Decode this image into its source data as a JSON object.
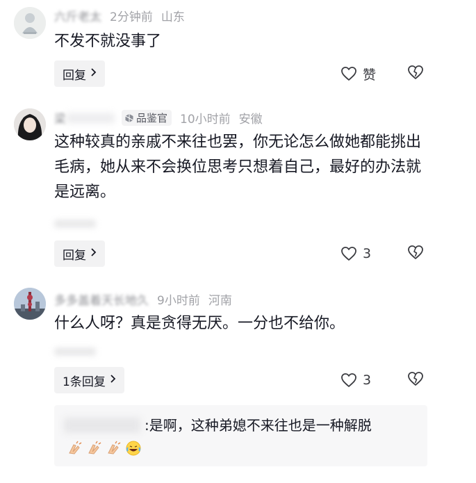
{
  "comments": [
    {
      "author": "六斤老太",
      "time": "2分钟前",
      "location": "山东",
      "text": "不发不就没事了",
      "reply_label": "回复",
      "like_label": "赞"
    },
    {
      "author": "梁",
      "badge": "品鉴官",
      "time": "10小时前",
      "location": "安徽",
      "text": "这种较真的亲戚不来往也罢，你无论怎么做她都能挑出毛病，她从来不会换位思考只想着自己，最好的办法就是远离。",
      "reply_label": "回复",
      "like_count": "3"
    },
    {
      "author": "多多盖着天长地久",
      "time": "9小时前",
      "location": "河南",
      "text": "什么人呀？真是贪得无厌。一分也不给你。",
      "reply_label": "1条回复",
      "like_count": "3",
      "sub_reply": {
        "text": ":是啊，这种弟媳不来往也是一种解脱"
      }
    }
  ],
  "colors": {
    "text": "#161823",
    "meta": "#a1a2a7",
    "button_bg": "#f2f2f3",
    "sub_bg": "#f7f7f8"
  },
  "icons": [
    "heart-outline-icon",
    "broken-heart-icon",
    "chevron-right-icon",
    "gem-badge-icon",
    "clap-emoji-icon",
    "laugh-cry-emoji-icon"
  ]
}
